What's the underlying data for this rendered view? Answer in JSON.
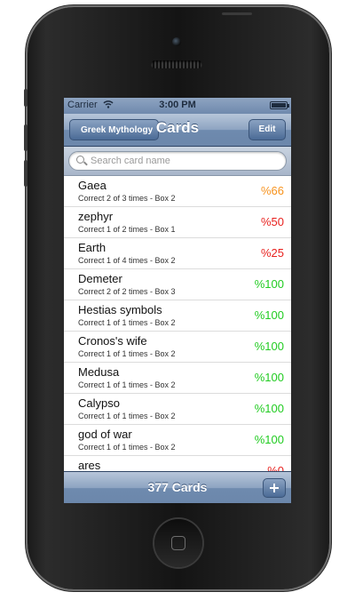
{
  "status_bar": {
    "carrier": "Carrier",
    "wifi_icon": "wifi-icon",
    "time": "3:00 PM",
    "battery_icon": "battery-icon"
  },
  "nav": {
    "back_label": "Greek Mythology",
    "title": "Cards",
    "edit_label": "Edit"
  },
  "search": {
    "placeholder": "Search card name",
    "value": "",
    "icon": "search-icon"
  },
  "cards": [
    {
      "name": "Gaea",
      "detail": "Correct 2 of 3 times - Box 2",
      "percent": "%66",
      "color": "#f7931e"
    },
    {
      "name": "zephyr",
      "detail": "Correct 1 of 2 times - Box 1",
      "percent": "%50",
      "color": "#e8221f"
    },
    {
      "name": "Earth",
      "detail": "Correct 1 of 4 times - Box 2",
      "percent": "%25",
      "color": "#e8221f"
    },
    {
      "name": "Demeter",
      "detail": "Correct 2 of 2 times - Box 3",
      "percent": "%100",
      "color": "#22cc22"
    },
    {
      "name": "Hestias symbols",
      "detail": "Correct 1 of 1 times - Box 2",
      "percent": "%100",
      "color": "#22cc22"
    },
    {
      "name": "Cronos's wife",
      "detail": "Correct 1 of 1 times - Box 2",
      "percent": "%100",
      "color": "#22cc22"
    },
    {
      "name": "Medusa",
      "detail": "Correct 1 of 1 times - Box 2",
      "percent": "%100",
      "color": "#22cc22"
    },
    {
      "name": "Calypso",
      "detail": "Correct 1 of 1 times - Box 2",
      "percent": "%100",
      "color": "#22cc22"
    },
    {
      "name": "god of war",
      "detail": "Correct 1 of 1 times - Box 2",
      "percent": "%100",
      "color": "#22cc22"
    },
    {
      "name": "ares",
      "detail": "",
      "percent": "%0",
      "color": "#e8221f"
    }
  ],
  "toolbar": {
    "count_label": "377 Cards",
    "add_icon": "plus-icon"
  },
  "colors": {
    "nav_blue": "#6e8aae",
    "orange": "#f7931e",
    "red": "#e8221f",
    "green": "#22cc22"
  }
}
